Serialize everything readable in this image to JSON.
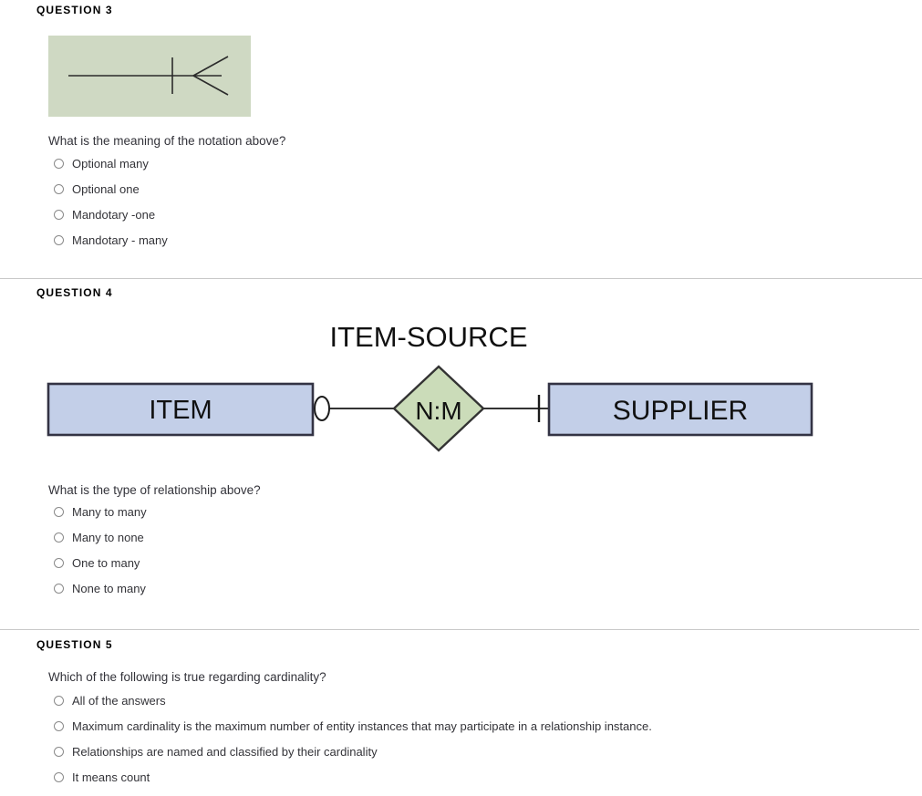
{
  "page": {
    "background": "#ffffff",
    "divider_color": "#c9c9c9"
  },
  "questions": [
    {
      "heading": "QUESTION 3",
      "prompt": "What is the meaning of the notation above?",
      "figure": {
        "type": "crows-foot-notation",
        "background_color": "#cfd9c3",
        "stroke_color": "#2b2b2b",
        "description": "horizontal line with one vertical bar and a crow's foot"
      },
      "options": [
        "Optional many",
        "Optional one",
        "Mandotary -one",
        "Mandotary - many"
      ]
    },
    {
      "heading": "QUESTION 4",
      "prompt": "What is the type of relationship above?",
      "figure": {
        "type": "er-diagram",
        "relationship_title": "ITEM-SOURCE",
        "left_entity": "ITEM",
        "right_entity": "SUPPLIER",
        "relationship_label": "N:M",
        "entity_fill": "#c3cfe8",
        "entity_border": "#333344",
        "diamond_fill": "#cbdcb9",
        "diamond_border": "#333333",
        "line_color": "#333333",
        "left_connector": "optional-zero",
        "right_connector": "mandatory-one"
      },
      "options": [
        "Many to many",
        "Many to none",
        "One to many",
        "None to many"
      ]
    },
    {
      "heading": "QUESTION 5",
      "prompt": "Which of the following is true regarding cardinality?",
      "options": [
        "All of the answers",
        "Maximum cardinality is the maximum number of entity instances that may participate in a relationship instance.",
        "Relationships are named and classified by their cardinality",
        "It means count"
      ]
    }
  ]
}
